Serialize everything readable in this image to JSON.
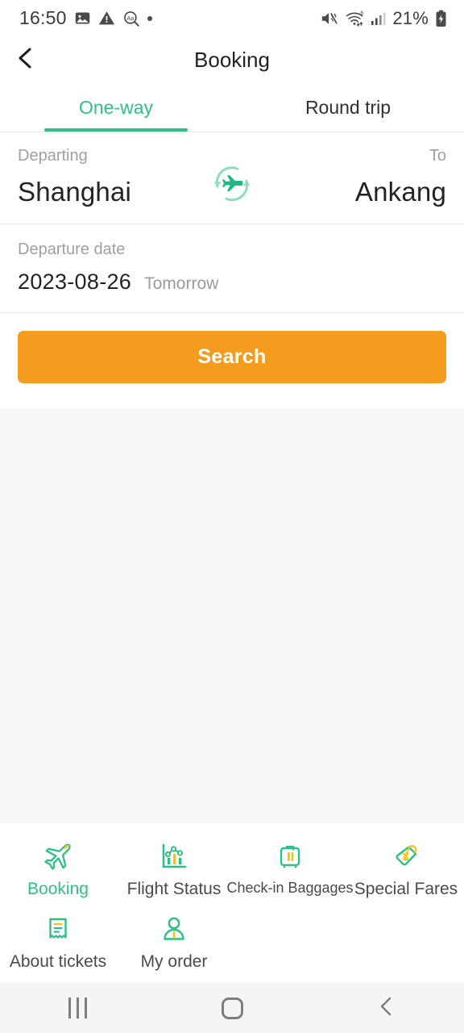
{
  "status_bar": {
    "time": "16:50",
    "battery_percent": "21%",
    "left_icons": [
      "image-icon",
      "warning-icon",
      "translate-icon",
      "dot-icon"
    ],
    "right_icons": [
      "mute-icon",
      "wifi-6-icon",
      "cellular-signal-icon",
      "battery-charging-icon"
    ]
  },
  "header": {
    "title": "Booking",
    "back_icon": "chevron-left-icon"
  },
  "tabs": [
    {
      "label": "One-way",
      "active": true
    },
    {
      "label": "Round trip",
      "active": false
    }
  ],
  "form": {
    "departing_label": "Departing",
    "to_label": "To",
    "departing_city": "Shanghai",
    "to_city": "Ankang",
    "swap_icon": "swap-route-plane-icon",
    "departure_date_label": "Departure date",
    "departure_date": "2023-08-26",
    "departure_date_relative": "Tomorrow",
    "search_label": "Search"
  },
  "bottom_nav": [
    {
      "label": "Booking",
      "icon": "airplane-icon",
      "active": true,
      "small": false
    },
    {
      "label": "Flight Status",
      "icon": "chart-icon",
      "active": false,
      "small": false
    },
    {
      "label": "Check-in Baggages",
      "icon": "suitcase-icon",
      "active": false,
      "small": true
    },
    {
      "label": "Special Fares",
      "icon": "price-tag-icon",
      "active": false,
      "small": false
    },
    {
      "label": "About tickets",
      "icon": "receipt-icon",
      "active": false,
      "small": false
    },
    {
      "label": "My order",
      "icon": "person-icon",
      "active": false,
      "small": false
    }
  ],
  "android_nav": {
    "recents": "recents-icon",
    "home": "home-icon",
    "back": "back-icon"
  },
  "colors": {
    "accent_green": "#2fc08a",
    "accent_orange": "#f49c1e",
    "accent_yellow": "#f5c11e",
    "text_primary": "#232323",
    "text_muted": "#9b9b9b",
    "page_bg": "#f7f7f7"
  }
}
